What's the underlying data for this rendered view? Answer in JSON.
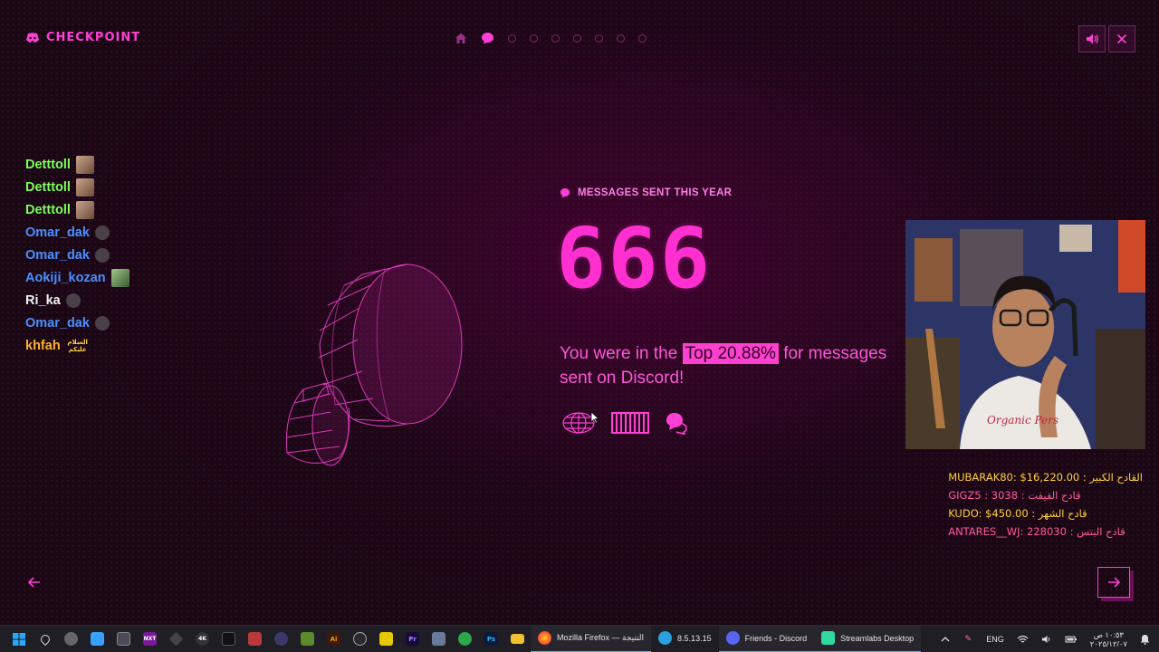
{
  "header": {
    "brand": "CHECKPOINT",
    "nav_dots": 7
  },
  "chat": {
    "messages": [
      {
        "user": "Detttoll",
        "color": "#7cff5a"
      },
      {
        "user": "Detttoll",
        "color": "#7cff5a"
      },
      {
        "user": "Detttoll",
        "color": "#7cff5a"
      },
      {
        "user": "Omar_dak",
        "color": "#4a90ff"
      },
      {
        "user": "Omar_dak",
        "color": "#4a90ff"
      },
      {
        "user": "Aokiji_kozan",
        "color": "#4a90ff"
      },
      {
        "user": "Ri_ka",
        "color": "#f2f2f2"
      },
      {
        "user": "Omar_dak",
        "color": "#4a90ff"
      },
      {
        "user": "khfah",
        "color": "#ffb030",
        "emote_text": "السلام عليكم"
      }
    ]
  },
  "stat": {
    "label": "MESSAGES SENT THIS YEAR",
    "value": "666",
    "text_before": "You were in the ",
    "highlight": "Top 20.88%",
    "text_after": " for messages sent on Discord!"
  },
  "donations": [
    {
      "text": "القادح الكبير : MUBARAK80: $16,220.00",
      "color": "#ffd23a"
    },
    {
      "text": "قادح القيفت : GIGZ5 : 3038",
      "color": "#ff5a9a"
    },
    {
      "text": "قادح الشهر : KUDO: $450.00",
      "color": "#ffd23a"
    },
    {
      "text": "قادح البتس : ANTARES__WJ: 228030",
      "color": "#ff5a9a"
    }
  ],
  "taskbar": {
    "apps": [
      {
        "label": "Mozilla Firefox — النتيجة"
      },
      {
        "label": "8.5.13.15"
      },
      {
        "label": "Friends - Discord"
      },
      {
        "label": "Streamlabs Desktop"
      }
    ],
    "tray": {
      "language": "ENG",
      "time": "١٠:٥٣ ص",
      "date": "٢٠٢٥/١٢/٠٧"
    }
  },
  "colors": {
    "accent": "#ff3fd6",
    "background": "#1a0714"
  },
  "icons": [
    "discord-icon",
    "home-icon",
    "chat-bubble-icon",
    "volume-icon",
    "close-icon",
    "globe-icon",
    "barcode-icon",
    "speech-bubbles-icon",
    "arrow-left-icon",
    "arrow-right-icon"
  ]
}
